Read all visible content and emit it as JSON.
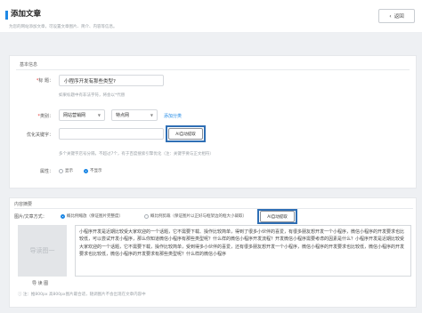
{
  "header": {
    "title": "添加文章",
    "subtitle": "为您的网站添加文章，可设置文章图片、简介、内容等信息。",
    "back_label": "返回"
  },
  "basic": {
    "section_title": "基本信息",
    "title_label": "标  题",
    "title_value": "小程序开发有那些类型?",
    "title_hint": "如果标题中有非法字符，将会以*代替",
    "category_label": "类别",
    "category_1": "网站营销网",
    "category_2": "特点网",
    "add_category": "添加分类",
    "keywords_label": "优化关键字",
    "keywords_value": "",
    "ai_extract_label": "AI自动提取",
    "keywords_hint": "多个关键字店号分隔，不超过7个，有于百度搜索引擎优化（注：关键字要与正文相符）",
    "attr_label": "属性",
    "attr_show": "显示",
    "attr_hide": "不显示"
  },
  "content": {
    "section_title": "内容摘要",
    "cover_label": "图片/文章方式",
    "mode_1": "概比例缩放（保证图片完整度）",
    "mode_2": "概比例剪裁（保证图片以正好与框架边的框大小裁取）",
    "ai_extract_label": "AI自动提取",
    "thumb_text": "导读图一",
    "upload_label": "导 读 图",
    "summary": "小程序开发是近期比较受大家欢迎的一个话题，它不需要下载、操作比较简单，得到了很多小伙伴的喜爱，有很多朋友想开发一个小程序，微信小程序的开发要求也比较低，可以尝试开发小程序，那么你知道微信小程序有那些类型呢？什么样的微信小程序开发流程？开发微信小程序需要考虑的因素是什么？小程序开发是近期比较受大家欢迎的一个话题，它不需要下载，操作比较简单，受到得多小伙伴的喜爱，还有很多朋友想开发一个小程序，微信小程序的开发要求也比较低，微信小程序的开发要求也比较低，微信小程序的开发要求有那些类型呢？什么样的微信小程序",
    "footnote": "注：推800px 高800px图片最合适，随调图片不会出现在文章内容中"
  }
}
